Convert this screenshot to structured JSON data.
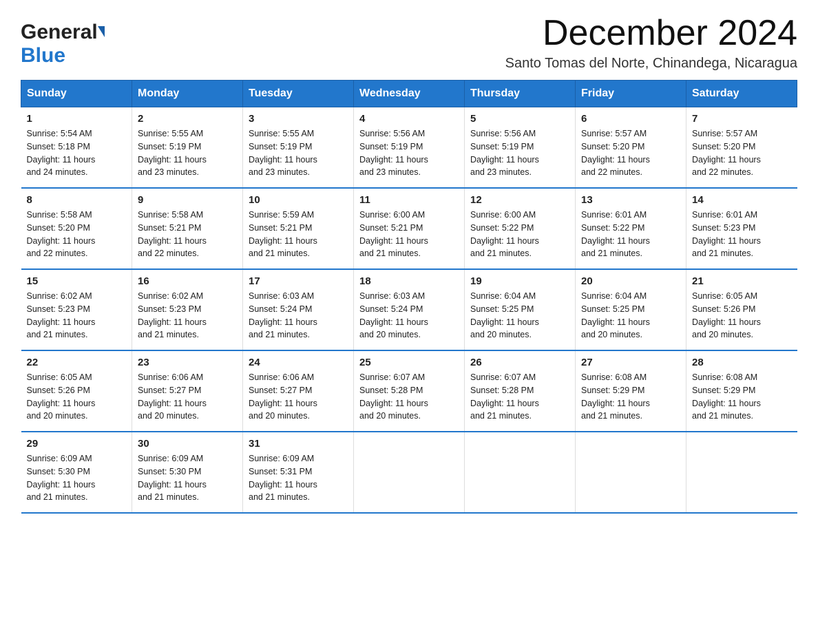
{
  "header": {
    "logo_general": "General",
    "logo_blue": "Blue",
    "month_title": "December 2024",
    "subtitle": "Santo Tomas del Norte, Chinandega, Nicaragua"
  },
  "days_of_week": [
    "Sunday",
    "Monday",
    "Tuesday",
    "Wednesday",
    "Thursday",
    "Friday",
    "Saturday"
  ],
  "weeks": [
    [
      {
        "day": "1",
        "sunrise": "5:54 AM",
        "sunset": "5:18 PM",
        "daylight": "11 hours and 24 minutes."
      },
      {
        "day": "2",
        "sunrise": "5:55 AM",
        "sunset": "5:19 PM",
        "daylight": "11 hours and 23 minutes."
      },
      {
        "day": "3",
        "sunrise": "5:55 AM",
        "sunset": "5:19 PM",
        "daylight": "11 hours and 23 minutes."
      },
      {
        "day": "4",
        "sunrise": "5:56 AM",
        "sunset": "5:19 PM",
        "daylight": "11 hours and 23 minutes."
      },
      {
        "day": "5",
        "sunrise": "5:56 AM",
        "sunset": "5:19 PM",
        "daylight": "11 hours and 23 minutes."
      },
      {
        "day": "6",
        "sunrise": "5:57 AM",
        "sunset": "5:20 PM",
        "daylight": "11 hours and 22 minutes."
      },
      {
        "day": "7",
        "sunrise": "5:57 AM",
        "sunset": "5:20 PM",
        "daylight": "11 hours and 22 minutes."
      }
    ],
    [
      {
        "day": "8",
        "sunrise": "5:58 AM",
        "sunset": "5:20 PM",
        "daylight": "11 hours and 22 minutes."
      },
      {
        "day": "9",
        "sunrise": "5:58 AM",
        "sunset": "5:21 PM",
        "daylight": "11 hours and 22 minutes."
      },
      {
        "day": "10",
        "sunrise": "5:59 AM",
        "sunset": "5:21 PM",
        "daylight": "11 hours and 21 minutes."
      },
      {
        "day": "11",
        "sunrise": "6:00 AM",
        "sunset": "5:21 PM",
        "daylight": "11 hours and 21 minutes."
      },
      {
        "day": "12",
        "sunrise": "6:00 AM",
        "sunset": "5:22 PM",
        "daylight": "11 hours and 21 minutes."
      },
      {
        "day": "13",
        "sunrise": "6:01 AM",
        "sunset": "5:22 PM",
        "daylight": "11 hours and 21 minutes."
      },
      {
        "day": "14",
        "sunrise": "6:01 AM",
        "sunset": "5:23 PM",
        "daylight": "11 hours and 21 minutes."
      }
    ],
    [
      {
        "day": "15",
        "sunrise": "6:02 AM",
        "sunset": "5:23 PM",
        "daylight": "11 hours and 21 minutes."
      },
      {
        "day": "16",
        "sunrise": "6:02 AM",
        "sunset": "5:23 PM",
        "daylight": "11 hours and 21 minutes."
      },
      {
        "day": "17",
        "sunrise": "6:03 AM",
        "sunset": "5:24 PM",
        "daylight": "11 hours and 21 minutes."
      },
      {
        "day": "18",
        "sunrise": "6:03 AM",
        "sunset": "5:24 PM",
        "daylight": "11 hours and 20 minutes."
      },
      {
        "day": "19",
        "sunrise": "6:04 AM",
        "sunset": "5:25 PM",
        "daylight": "11 hours and 20 minutes."
      },
      {
        "day": "20",
        "sunrise": "6:04 AM",
        "sunset": "5:25 PM",
        "daylight": "11 hours and 20 minutes."
      },
      {
        "day": "21",
        "sunrise": "6:05 AM",
        "sunset": "5:26 PM",
        "daylight": "11 hours and 20 minutes."
      }
    ],
    [
      {
        "day": "22",
        "sunrise": "6:05 AM",
        "sunset": "5:26 PM",
        "daylight": "11 hours and 20 minutes."
      },
      {
        "day": "23",
        "sunrise": "6:06 AM",
        "sunset": "5:27 PM",
        "daylight": "11 hours and 20 minutes."
      },
      {
        "day": "24",
        "sunrise": "6:06 AM",
        "sunset": "5:27 PM",
        "daylight": "11 hours and 20 minutes."
      },
      {
        "day": "25",
        "sunrise": "6:07 AM",
        "sunset": "5:28 PM",
        "daylight": "11 hours and 20 minutes."
      },
      {
        "day": "26",
        "sunrise": "6:07 AM",
        "sunset": "5:28 PM",
        "daylight": "11 hours and 21 minutes."
      },
      {
        "day": "27",
        "sunrise": "6:08 AM",
        "sunset": "5:29 PM",
        "daylight": "11 hours and 21 minutes."
      },
      {
        "day": "28",
        "sunrise": "6:08 AM",
        "sunset": "5:29 PM",
        "daylight": "11 hours and 21 minutes."
      }
    ],
    [
      {
        "day": "29",
        "sunrise": "6:09 AM",
        "sunset": "5:30 PM",
        "daylight": "11 hours and 21 minutes."
      },
      {
        "day": "30",
        "sunrise": "6:09 AM",
        "sunset": "5:30 PM",
        "daylight": "11 hours and 21 minutes."
      },
      {
        "day": "31",
        "sunrise": "6:09 AM",
        "sunset": "5:31 PM",
        "daylight": "11 hours and 21 minutes."
      },
      null,
      null,
      null,
      null
    ]
  ],
  "labels": {
    "sunrise": "Sunrise:",
    "sunset": "Sunset:",
    "daylight": "Daylight:"
  }
}
